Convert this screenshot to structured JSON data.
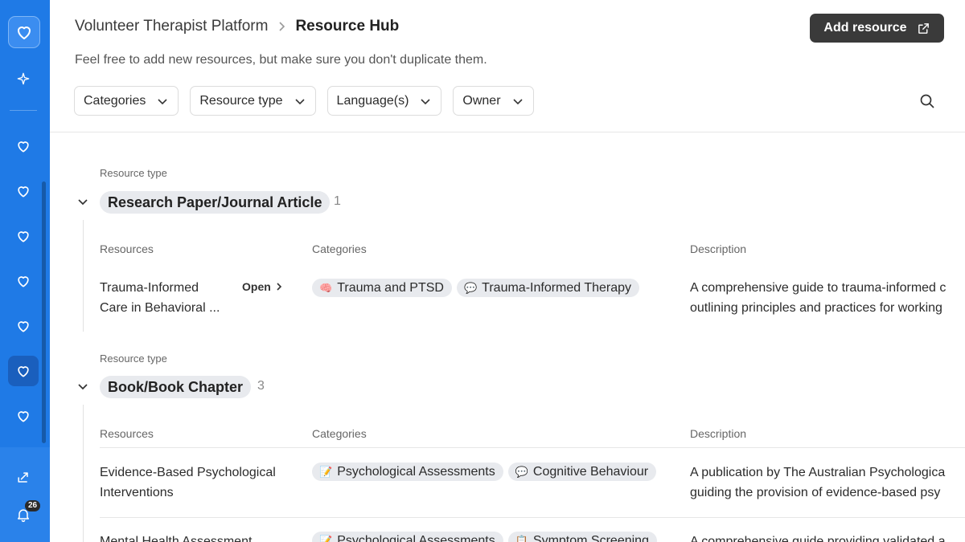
{
  "sidebar": {
    "notification_count": "26",
    "icons": [
      "heart-icon",
      "sparkle-icon",
      "heart-icon",
      "heart-icon",
      "heart-icon",
      "heart-icon",
      "heart-icon",
      "heart-icon",
      "heart-icon",
      "share-icon",
      "bell-icon"
    ]
  },
  "header": {
    "breadcrumb_root": "Volunteer Therapist Platform",
    "breadcrumb_current": "Resource Hub",
    "subtitle": "Feel free to add new resources, but make sure you don't duplicate them.",
    "add_button": "Add resource"
  },
  "filters": [
    "Categories",
    "Resource type",
    "Language(s)",
    "Owner"
  ],
  "groups": [
    {
      "label": "Resource type",
      "name": "Research Paper/Journal Article",
      "count": "1",
      "columns": [
        "Resources",
        "Categories",
        "Description"
      ],
      "rows": [
        {
          "name_line1": "Trauma-Informed",
          "name_line2": "Care in Behavioral ...",
          "open": "Open",
          "categories": [
            {
              "emoji": "🧠",
              "label": "Trauma and PTSD"
            },
            {
              "emoji": "💬",
              "label": "Trauma-Informed Therapy"
            }
          ],
          "desc_line1": "A comprehensive guide to trauma-informed c",
          "desc_line2": "outlining principles and practices for working"
        }
      ]
    },
    {
      "label": "Resource type",
      "name": "Book/Book Chapter",
      "count": "3",
      "columns": [
        "Resources",
        "Categories",
        "Description"
      ],
      "rows": [
        {
          "name_line1": "Evidence-Based Psychological",
          "name_line2": "Interventions",
          "categories": [
            {
              "emoji": "📝",
              "label": "Psychological Assessments"
            },
            {
              "emoji": "💬",
              "label": "Cognitive Behaviour"
            }
          ],
          "desc_line1": "A publication by The Australian Psychologica",
          "desc_line2": "guiding the provision of evidence-based psy"
        },
        {
          "name_line1": "Mental Health Assessment",
          "categories": [
            {
              "emoji": "📝",
              "label": "Psychological Assessments"
            },
            {
              "emoji": "📋",
              "label": "Symptom Screening"
            }
          ],
          "desc_line1": "A comprehensive guide providing validated a"
        }
      ]
    }
  ],
  "colors": {
    "sidebar": "#1f7ae6",
    "primary_button": "#3a3a3a",
    "pill_background": "#e8eaee"
  }
}
